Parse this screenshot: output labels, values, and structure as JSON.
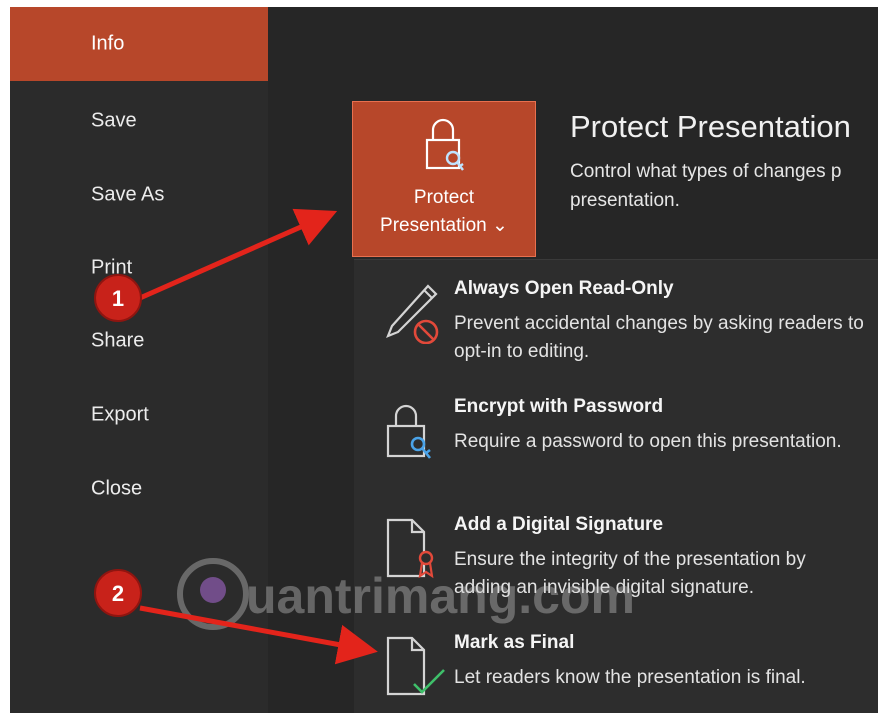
{
  "sidebar": {
    "items": [
      {
        "label": "Info",
        "active": true
      },
      {
        "label": "Save"
      },
      {
        "label": "Save As"
      },
      {
        "label": "Print"
      },
      {
        "label": "Share"
      },
      {
        "label": "Export"
      },
      {
        "label": "Close"
      }
    ]
  },
  "protect": {
    "button_line1": "Protect",
    "button_line2": "Presentation ⌄",
    "icon": "lock-key-icon",
    "title": "Protect Presentation",
    "description": "Control what types of changes p presentation."
  },
  "menu": {
    "items": [
      {
        "title": "Always Open Read-Only",
        "description": "Prevent accidental changes by asking readers to opt-in to editing.",
        "icon": "pencil-prohibit-icon"
      },
      {
        "title": "Encrypt with Password",
        "description": "Require a password to open this presentation.",
        "icon": "lock-key-icon"
      },
      {
        "title": "Add a Digital Signature",
        "description": "Ensure the integrity of the presentation by adding an invisible digital signature.",
        "icon": "document-ribbon-icon"
      },
      {
        "title": "Mark as Final",
        "description": "Let readers know the presentation is final.",
        "icon": "document-checkmark-icon"
      }
    ]
  },
  "annotations": {
    "badge1": "1",
    "badge2": "2"
  },
  "watermark": {
    "text": "uantrimang.com"
  },
  "colors": {
    "accent": "#b7472a",
    "badge": "#c8221a",
    "arrow": "#e3241b",
    "background": "#262626",
    "sidebar": "#2b2b2b"
  }
}
